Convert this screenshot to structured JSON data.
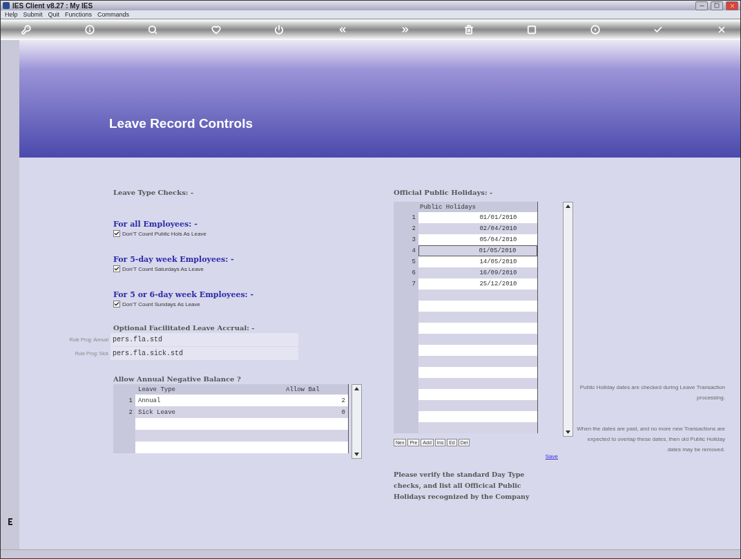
{
  "window": {
    "title": "IES Client v8.27 : My IES"
  },
  "menu": [
    "Help",
    "Submit",
    "Quit",
    "Functions",
    "Commands"
  ],
  "page_title": "Leave Record Controls",
  "leave_checks": {
    "heading": "Leave Type Checks: -",
    "sections": [
      {
        "heading": "For all Employees: -",
        "option": {
          "label": "Don'T Count Public Hols As Leave",
          "checked": true
        }
      },
      {
        "heading": "For 5-day week Employees: -",
        "option": {
          "label": "Don'T Count Saturdays As Leave",
          "checked": true
        }
      },
      {
        "heading": "For 5 or 6-day week Employees: -",
        "option": {
          "label": "Don'T Count Sundays As Leave",
          "checked": true
        }
      }
    ]
  },
  "accrual": {
    "heading": "Optional Facilitated Leave Accrual: -",
    "fields": [
      {
        "label": "Rule Prog: Annual",
        "value": "pers.fla.std"
      },
      {
        "label": "Rule Prog: Sick",
        "value": "pers.fla.sick.std"
      }
    ]
  },
  "negative_balance": {
    "heading": "Allow Annual Negative Balance ?",
    "columns": [
      "Leave Type",
      "Allow Bal"
    ],
    "rows": [
      {
        "number": "1",
        "leave_type": "Annual",
        "allow_bal": "2"
      },
      {
        "number": "2",
        "leave_type": "Sick Leave",
        "allow_bal": "0"
      }
    ]
  },
  "holidays": {
    "heading": "Official Public Holidays: -",
    "column": "Public Holidays",
    "rows": [
      {
        "number": "1",
        "date": "01/01/2010",
        "selected": false
      },
      {
        "number": "2",
        "date": "02/04/2010",
        "selected": false
      },
      {
        "number": "3",
        "date": "05/04/2010",
        "selected": false
      },
      {
        "number": "4",
        "date": "01/05/2010",
        "selected": true
      },
      {
        "number": "5",
        "date": "14/05/2010",
        "selected": false
      },
      {
        "number": "6",
        "date": "16/09/2010",
        "selected": false
      },
      {
        "number": "7",
        "date": "25/12/2010",
        "selected": false
      }
    ],
    "buttons": [
      "Nex",
      "Pre",
      "Add",
      "Ins",
      "Ed",
      "Del"
    ],
    "save": "Save",
    "instructions": "Please verify the standard Day Type checks, and list all Officical Public Holidays recognized by the Company"
  },
  "notes": [
    "Public Holiday dates are checked during Leave Transaction processing.",
    "When the dates are past, and no more new Transactions are expected to overlap these dates, then old Public Holiday dates may be removed."
  ]
}
